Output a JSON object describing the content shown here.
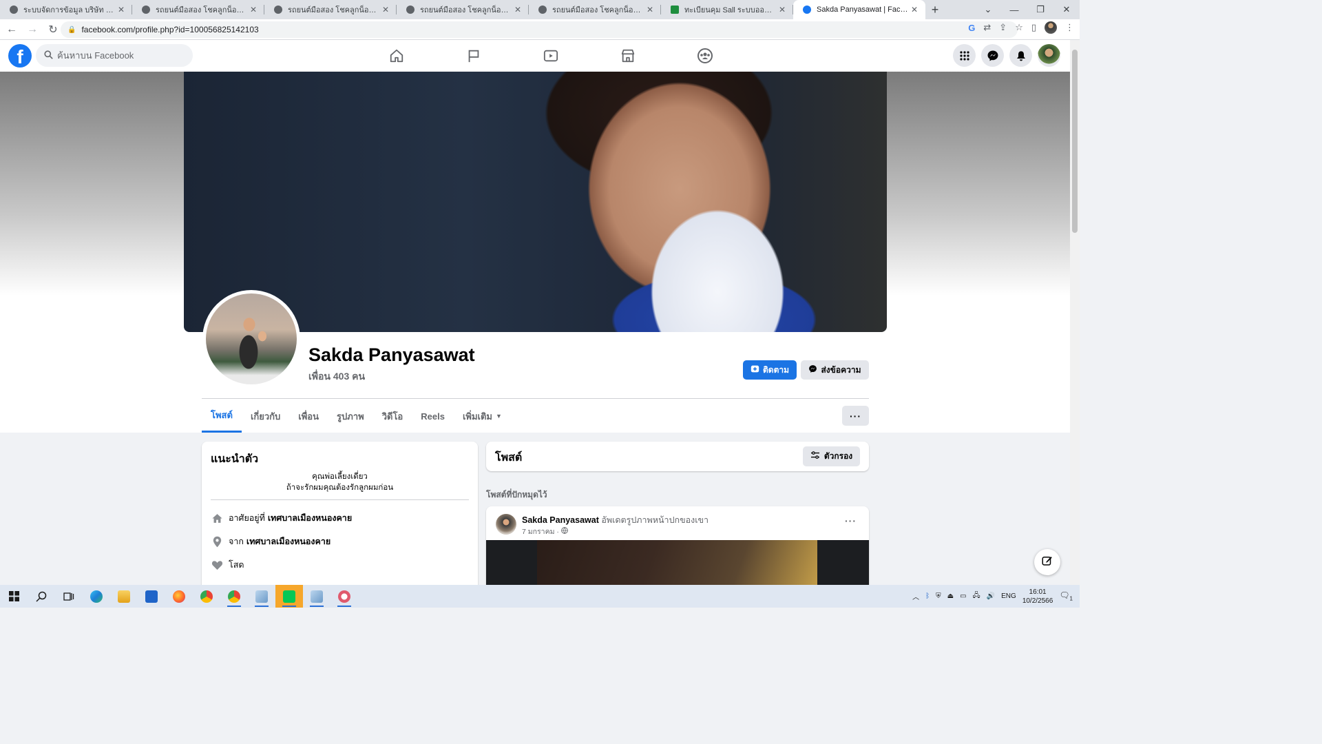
{
  "browser": {
    "tabs": [
      {
        "title": "ระบบจัดการข้อมูล บริษัท โชคลูกน็อต",
        "favicon": "globe-icon"
      },
      {
        "title": "รถยนต์มือสอง โชคลูกน็อต อุดรธานี",
        "favicon": "car-logo-icon"
      },
      {
        "title": "รถยนต์มือสอง โชคลูกน็อต อุดรธานี",
        "favicon": "car-logo-icon"
      },
      {
        "title": "รถยนต์มือสอง โชคลูกน็อต อุดรธานี",
        "favicon": "car-logo-icon"
      },
      {
        "title": "รถยนต์มือสอง โชคลูกน็อต อุดรธานี",
        "favicon": "car-logo-icon"
      },
      {
        "title": "ทะเบียนคุม Sall ระบบออนไลน์.xlsx - G",
        "favicon": "sheets-icon"
      },
      {
        "title": "Sakda Panyasawat | Facebook",
        "favicon": "facebook-icon",
        "active": true
      }
    ],
    "url": "facebook.com/profile.php?id=100056825142103"
  },
  "fb": {
    "search_placeholder": "ค้นหาบน Facebook",
    "accent": "#1b74e4",
    "nav": [
      "home-icon",
      "pages-flag-icon",
      "watch-icon",
      "marketplace-icon",
      "groups-icon"
    ]
  },
  "profile": {
    "name": "Sakda Panyasawat",
    "friends": "เพื่อน 403 คน",
    "follow_label": "ติดตาม",
    "message_label": "ส่งข้อความ",
    "tabs": [
      "โพสต์",
      "เกี่ยวกับ",
      "เพื่อน",
      "รูปภาพ",
      "วิดีโอ",
      "Reels",
      "เพิ่มเติม"
    ],
    "more_label": "···"
  },
  "intro": {
    "title": "แนะนำตัว",
    "bio_line1": "คุณพ่อเลี้ยงเดี่ยว",
    "bio_line2": "ถ้าจะรักผมคุณต้องรักลูกผมก่อน",
    "lives_prefix": "อาศัยอยู่ที่",
    "lives_place": "เทศบาลเมืองหนองคาย",
    "from_prefix": "จาก",
    "from_place": "เทศบาลเมืองหนองคาย",
    "relationship": "โสด"
  },
  "posts": {
    "title": "โพสต์",
    "filter_label": "ตัวกรอง",
    "pinned_label": "โพสต์ที่ปักหมุดไว้",
    "post": {
      "author": "Sakda Panyasawat",
      "action": "อัพเดตรูปภาพหน้าปกของเขา",
      "date": "7 มกราคม ·"
    }
  },
  "taskbar": {
    "lang": "ENG",
    "time": "16:01",
    "date": "10/2/2566",
    "notifications": "1"
  }
}
